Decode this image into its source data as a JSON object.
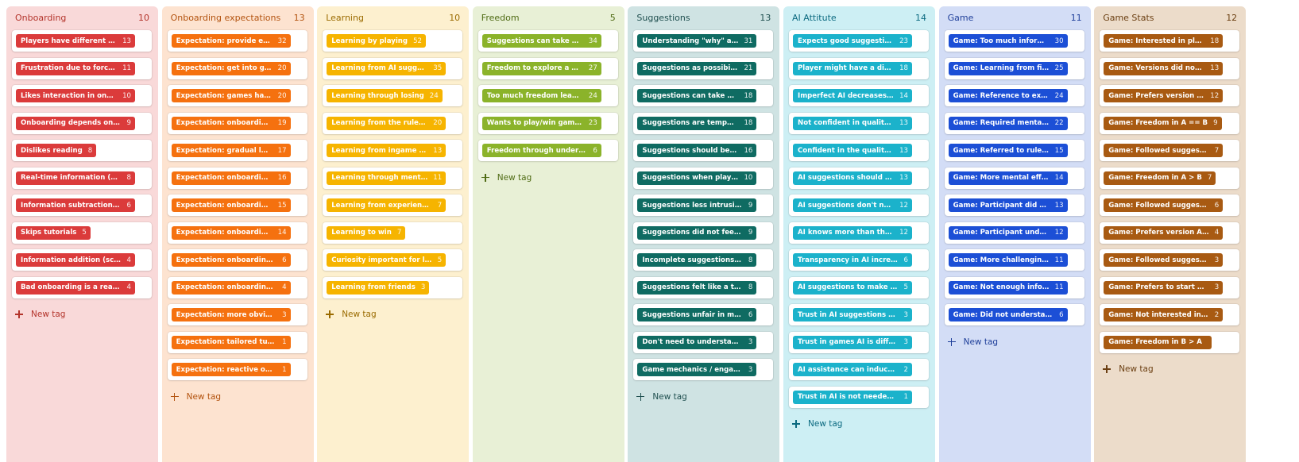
{
  "new_tag_label": "New tag",
  "columns": [
    {
      "title": "Onboarding",
      "count": "10",
      "bg": "#f9d9d9",
      "header_color": "#b3342b",
      "tag_color": "#db3b3b",
      "tags": [
        {
          "label": "Players have different needs",
          "count": "13"
        },
        {
          "label": "Frustration due to forced tutor...",
          "count": "11"
        },
        {
          "label": "Likes interaction in onboarding",
          "count": "10"
        },
        {
          "label": "Onboarding depends on game c...",
          "count": "9"
        },
        {
          "label": "Dislikes reading",
          "count": "8"
        },
        {
          "label": "Real-time information (advisor)",
          "count": "8"
        },
        {
          "label": "Information subtraction (trainin...",
          "count": "6"
        },
        {
          "label": "Skips tutorials",
          "count": "5"
        },
        {
          "label": "Information addition (scaffoldin...",
          "count": "4"
        },
        {
          "label": "Bad onboarding is a reason to q...",
          "count": "4"
        }
      ]
    },
    {
      "title": "Onboarding expectations",
      "count": "13",
      "bg": "#fde3d0",
      "header_color": "#b3530f",
      "tag_color": "#f5710f",
      "tags": [
        {
          "label": "Expectation: provide enough i...",
          "count": "32"
        },
        {
          "label": "Expectation: get into gamepla...",
          "count": "20"
        },
        {
          "label": "Expectation: games have tutori...",
          "count": "20"
        },
        {
          "label": "Expectation: onboarding has fr...",
          "count": "19"
        },
        {
          "label": "Expectation: gradual learning",
          "count": "17"
        },
        {
          "label": "Expectation: onboarding shoul...",
          "count": "16"
        },
        {
          "label": "Expectation: onboarding does...",
          "count": "15"
        },
        {
          "label": "Expectation: onboarding has e...",
          "count": "14"
        },
        {
          "label": "Expectation: onboarding should...",
          "count": "6"
        },
        {
          "label": "Expectation: onboarding provid...",
          "count": "4"
        },
        {
          "label": "Expectation: more obvious sugg...",
          "count": "3"
        },
        {
          "label": "Expectation: tailored tutorials / ...",
          "count": "1"
        },
        {
          "label": "Expectation: reactive onboardin...",
          "count": "1"
        }
      ]
    },
    {
      "title": "Learning",
      "count": "10",
      "bg": "#fdf0cf",
      "header_color": "#9a6b00",
      "tag_color": "#f6b400",
      "tags": [
        {
          "label": "Learning by playing",
          "count": "52"
        },
        {
          "label": "Learning from AI suggestions",
          "count": "35"
        },
        {
          "label": "Learning through losing",
          "count": "24"
        },
        {
          "label": "Learning from the rulebook / ...",
          "count": "20"
        },
        {
          "label": "Learning from ingame opponent",
          "count": "13"
        },
        {
          "label": "Learning through mental effort",
          "count": "11"
        },
        {
          "label": "Learning from experience with ...",
          "count": "7"
        },
        {
          "label": "Learning to win",
          "count": "7"
        },
        {
          "label": "Curiosity important for learning",
          "count": "5"
        },
        {
          "label": "Learning from friends",
          "count": "3"
        }
      ]
    },
    {
      "title": "Freedom",
      "count": "5",
      "bg": "#e8f0d6",
      "header_color": "#4f6b14",
      "tag_color": "#8bb32a",
      "tags": [
        {
          "label": "Suggestions can take away fre...",
          "count": "34"
        },
        {
          "label": "Freedom to explore a game",
          "count": "27"
        },
        {
          "label": "Too much freedom leaves play...",
          "count": "24"
        },
        {
          "label": "Wants to play/win games by o...",
          "count": "23"
        },
        {
          "label": "Freedom through understandin...",
          "count": "6"
        }
      ]
    },
    {
      "title": "Suggestions",
      "count": "13",
      "bg": "#cfe3e3",
      "header_color": "#1f4f4f",
      "tag_color": "#0f6b62",
      "tags": [
        {
          "label": "Understanding \"why\" a sugges...",
          "count": "31"
        },
        {
          "label": "Suggestions as possibilities",
          "count": "21"
        },
        {
          "label": "Suggestions can take away cur...",
          "count": "18"
        },
        {
          "label": "Suggestions are temporary su...",
          "count": "18"
        },
        {
          "label": "Suggestions should be voluntary",
          "count": "16"
        },
        {
          "label": "Suggestions when player is stuck",
          "count": "10"
        },
        {
          "label": "Suggestions less intrusive than f...",
          "count": "9"
        },
        {
          "label": "Suggestions did not feel like a t...",
          "count": "9"
        },
        {
          "label": "Incomplete suggestions trigger ...",
          "count": "8"
        },
        {
          "label": "Suggestions felt like a tutorial",
          "count": "8"
        },
        {
          "label": "Suggestions unfair in multiplay...",
          "count": "6"
        },
        {
          "label": "Don't need to understand \"why...",
          "count": "3"
        },
        {
          "label": "Game mechanics / engagement ...",
          "count": "3"
        }
      ]
    },
    {
      "title": "AI Attitute",
      "count": "14",
      "bg": "#cdeff4",
      "header_color": "#0b6a80",
      "tag_color": "#1bb2cb",
      "tags": [
        {
          "label": "Expects good suggestions fro...",
          "count": "23"
        },
        {
          "label": "Player might have a different s...",
          "count": "18"
        },
        {
          "label": "Imperfect AI decreases trust",
          "count": "14"
        },
        {
          "label": "Not confident in quality of AI s...",
          "count": "13"
        },
        {
          "label": "Confident in the quality of AI s...",
          "count": "13"
        },
        {
          "label": "AI suggestions should show m...",
          "count": "13"
        },
        {
          "label": "AI suggestions don't need to b...",
          "count": "12"
        },
        {
          "label": "AI knows more than the player",
          "count": "12"
        },
        {
          "label": "Transparency in AI increases trust",
          "count": "6"
        },
        {
          "label": "AI suggestions to make onboar...",
          "count": "5"
        },
        {
          "label": "Trust in AI suggestions varies be...",
          "count": "3"
        },
        {
          "label": "Trust in games AI is different th...",
          "count": "3"
        },
        {
          "label": "AI assistance can induce pressur...",
          "count": "2"
        },
        {
          "label": "Trust in AI is not needed in onb...",
          "count": "1"
        }
      ]
    },
    {
      "title": "Game",
      "count": "11",
      "bg": "#d3ddf6",
      "header_color": "#1f3f9a",
      "tag_color": "#1c4fd6",
      "tags": [
        {
          "label": "Game: Too much information",
          "count": "30"
        },
        {
          "label": "Game: Learning from first game",
          "count": "25"
        },
        {
          "label": "Game: Reference to existing g...",
          "count": "24"
        },
        {
          "label": "Game: Required mental effort",
          "count": "22"
        },
        {
          "label": "Game: Referred to rulebook du...",
          "count": "15"
        },
        {
          "label": "Game: More mental effort wit...",
          "count": "14"
        },
        {
          "label": "Game: Participant did not und...",
          "count": "13"
        },
        {
          "label": "Game: Participant understood ...",
          "count": "12"
        },
        {
          "label": "Game: More challenging witho...",
          "count": "11"
        },
        {
          "label": "Game: Not enough informatio...",
          "count": "11"
        },
        {
          "label": "Game: Did not understand / not...",
          "count": "6"
        }
      ]
    },
    {
      "title": "Game Stats",
      "count": "12",
      "bg": "#ecdcca",
      "header_color": "#6b3f12",
      "tag_color": "#a85a12",
      "tags": [
        {
          "label": "Game: Interested in playing ag...",
          "count": "18"
        },
        {
          "label": "Game: Versions did not feel dif...",
          "count": "13"
        },
        {
          "label": "Game: Prefers version B > A",
          "count": "12"
        },
        {
          "label": "Game: Freedom in A == B",
          "count": "9"
        },
        {
          "label": "Game: Followed suggestions so...",
          "count": "7"
        },
        {
          "label": "Game: Freedom in A > B",
          "count": "7"
        },
        {
          "label": "Game: Followed suggestions al...",
          "count": "6"
        },
        {
          "label": "Game: Prefers version A > B",
          "count": "4"
        },
        {
          "label": "Game: Followed suggestions ne...",
          "count": "3"
        },
        {
          "label": "Game: Prefers to start with B bu...",
          "count": "3"
        },
        {
          "label": "Game: Not interested in playing...",
          "count": "2"
        },
        {
          "label": "Game: Freedom in B > A",
          "count": ""
        }
      ]
    }
  ]
}
